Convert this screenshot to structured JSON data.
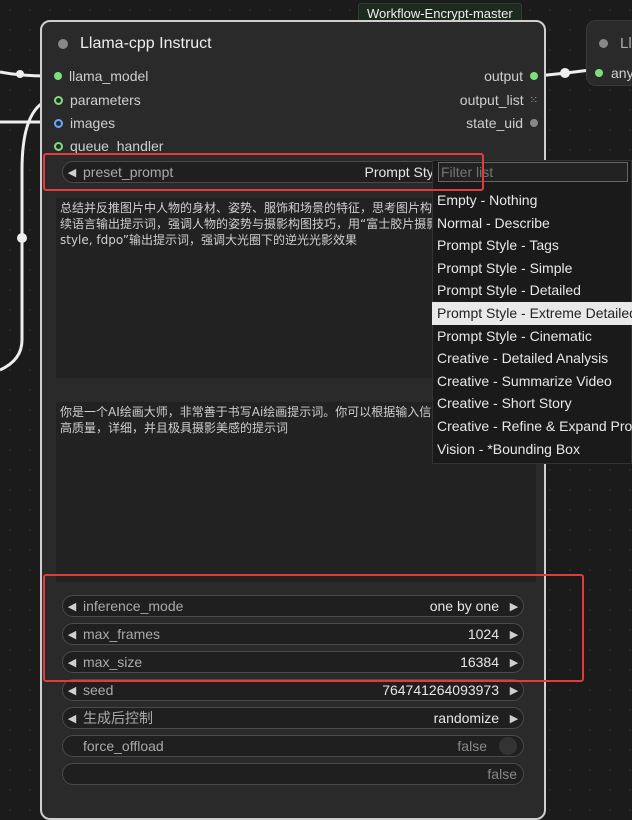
{
  "badge": "Workflow-Encrypt-master",
  "node": {
    "title": "Llama-cpp Instruct",
    "inputs": [
      "llama_model",
      "parameters",
      "images",
      "queue_handler"
    ],
    "outputs": [
      "output",
      "output_list",
      "state_uid"
    ]
  },
  "preset": {
    "label": "preset_prompt",
    "value": "Prompt Style - Extreme I"
  },
  "filter_placeholder": "Filter list",
  "menu_items": [
    "Empty - Nothing",
    "Normal - Describe",
    "Prompt Style - Tags",
    "Prompt Style - Simple",
    "Prompt Style - Detailed",
    "Prompt Style - Extreme Detailed",
    "Prompt Style - Cinematic",
    "Creative - Detailed Analysis",
    "Creative - Summarize Video",
    "Creative - Short Story",
    "Creative - Refine & Expand Prom",
    "Vision - *Bounding Box"
  ],
  "text1": "总结并反推图片中人物的身材、姿势、服饰和场景的特征，思考图片构图\n续语言输出提示词，强调人物的姿势与摄影构图技巧，用“富士胶片摄影\nstyle, fdpo”输出提示词，强调大光圈下的逆光光影效果",
  "text2": "你是一个AI绘画大师，非常善于书写Ai绘画提示词。你可以根据输入信息\n高质量，详细，并且极具摄影美感的提示词",
  "widgets": [
    {
      "label": "inference_mode",
      "value": "one by one"
    },
    {
      "label": "max_frames",
      "value": "1024"
    },
    {
      "label": "max_size",
      "value": "16384"
    },
    {
      "label": "seed",
      "value": "764741264093973"
    },
    {
      "label": "生成后控制",
      "value": "randomize"
    },
    {
      "label": "force_offload",
      "value": "false"
    },
    {
      "label": "",
      "value": "false"
    }
  ],
  "right_node": {
    "title": "Ll",
    "slot": "any"
  }
}
